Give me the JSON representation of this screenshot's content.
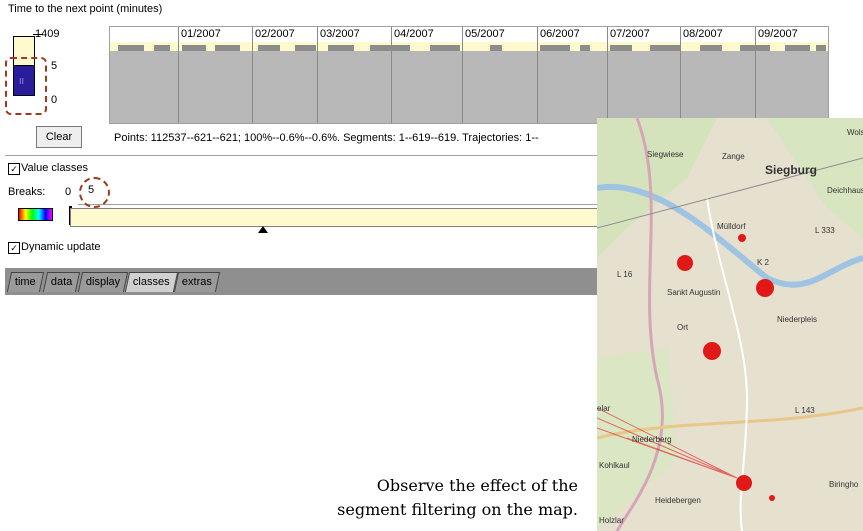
{
  "header": {
    "caption": "Time to the next point (minutes)"
  },
  "legend": {
    "max": "1409",
    "mid": "5",
    "min": "0",
    "marker": "⁝⁝"
  },
  "timeline": {
    "months": [
      "01/2007",
      "02/2007",
      "03/2007",
      "04/2007",
      "05/2007",
      "06/2007",
      "07/2007",
      "08/2007",
      "09/2007"
    ]
  },
  "controls": {
    "clear_label": "Clear",
    "status": "Points: 112537--621--621; 100%--0.6%--0.6%. Segments: 1--619--619. Trajectories: 1--"
  },
  "classes": {
    "value_classes_label": "Value classes",
    "breaks_label": "Breaks:",
    "breaks_first": "0",
    "breaks_value": "5",
    "dynamic_update_label": "Dynamic update",
    "check_mark": "✓"
  },
  "tabs": [
    {
      "label": "time"
    },
    {
      "label": "data"
    },
    {
      "label": "display"
    },
    {
      "label": "classes",
      "active": true
    },
    {
      "label": "extras"
    }
  ],
  "explanation": {
    "line1": "Observe the effect of the",
    "line2": "segment filtering on the map."
  },
  "map": {
    "labels": [
      "Wols",
      "Zange",
      "Siegburg",
      "Deichhaus",
      "Mülldorf",
      "Sankt Augustin",
      "Niederpleis",
      "Ort",
      "Niederberg",
      "L 143",
      "Kohlkaul",
      "Heidebergen",
      "Holzlar",
      "Biringho",
      "L 333",
      "K 2",
      "L 16",
      "elar",
      "Siegwiese"
    ]
  },
  "colors": {
    "accent_dashed": "#9e3a1f",
    "legend_dark": "#2a1d9c",
    "legend_light": "#fffacd",
    "tab_bar": "#8f8f8f",
    "map_hotspot": "#e01818"
  }
}
